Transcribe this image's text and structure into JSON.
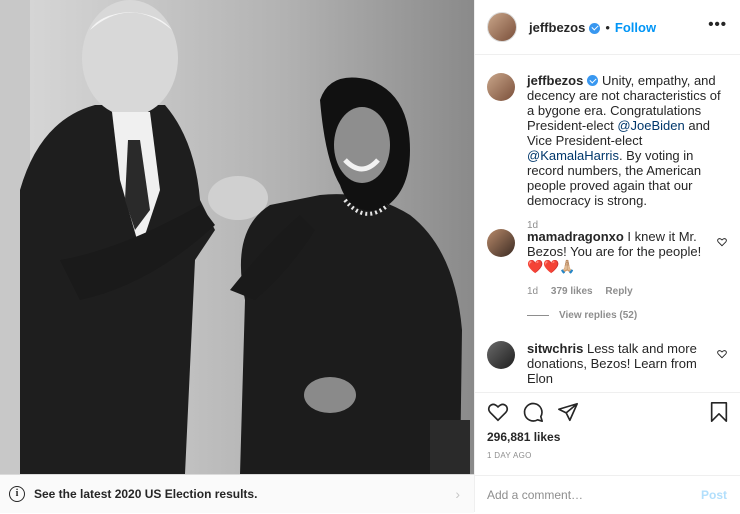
{
  "post": {
    "username": "jeffbezos",
    "follow_label": "Follow",
    "dot": "•",
    "more": "•••"
  },
  "banner": {
    "text": "See the latest 2020 US Election results."
  },
  "caption": {
    "username": "jeffbezos",
    "text_part1": " Unity, empathy, and decency are not characteristics of a bygone era. Congratulations President-elect ",
    "mention1": "@JoeBiden",
    "text_part2": " and Vice President-elect ",
    "mention2": "@KamalaHarris",
    "text_part3": ". By voting in record numbers, the American people proved again that our democracy is strong.",
    "age": "1d"
  },
  "comments": [
    {
      "username": "mamadragonxo",
      "text": " I knew it Mr. Bezos! You are for the people! ❤️❤️🙏🏼",
      "age": "1d",
      "likes": "379 likes",
      "reply": "Reply",
      "view_replies": "View replies (52)"
    },
    {
      "username": "sitwchris",
      "text": " Less talk and more donations, Bezos! Learn from Elon"
    }
  ],
  "actions": {
    "likes": "296,881 likes",
    "ago": "1 DAY AGO",
    "add_comment_placeholder": "Add a comment…",
    "post_label": "Post"
  },
  "icons": [
    "heart-icon",
    "comment-icon",
    "share-icon",
    "bookmark-icon",
    "info-icon",
    "chevron-right-icon",
    "verified-icon"
  ],
  "colors": {
    "link_blue": "#0095f6",
    "verified_blue": "#3897f0",
    "mention_blue": "#00376b",
    "muted_grey": "#8e8e8e",
    "post_disabled": "#b2dffc"
  }
}
